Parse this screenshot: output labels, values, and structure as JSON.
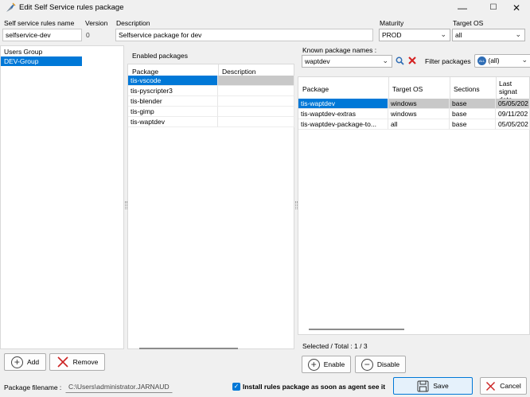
{
  "window": {
    "title": "Edit Self Service rules package",
    "min": "—",
    "max": "☐",
    "close": "✕"
  },
  "form": {
    "rules_name_label": "Self service rules name",
    "rules_name_value": "selfservice-dev",
    "version_label": "Version",
    "version_value": "0",
    "description_label": "Description",
    "description_value": "Selfservice package for dev",
    "maturity_label": "Maturity",
    "maturity_value": "PROD",
    "target_os_label": "Target OS",
    "target_os_value": "all"
  },
  "groups": {
    "header": "Users Group",
    "items": [
      "DEV-Group"
    ]
  },
  "enabled": {
    "title": "Enabled packages",
    "col_package": "Package",
    "col_description": "Description",
    "rows": [
      "tis-vscode",
      "tis-pyscripter3",
      "tis-blender",
      "tis-gimp",
      "tis-waptdev"
    ]
  },
  "known": {
    "label": "Known package names :",
    "search_value": "waptdev",
    "filter_label": "Filter packages",
    "filter_badge": "ALL",
    "filter_value": "(all)",
    "columns": [
      "Package",
      "Target OS",
      "Sections",
      "Last signature date"
    ],
    "col_last_line1": "Last signat",
    "col_last_line2": "date",
    "rows": [
      {
        "package": "tis-waptdev",
        "os": "windows",
        "section": "base",
        "date": "05/05/202"
      },
      {
        "package": "tis-waptdev-extras",
        "os": "windows",
        "section": "base",
        "date": "09/11/202"
      },
      {
        "package": "tis-waptdev-package-to...",
        "os": "all",
        "section": "base",
        "date": "05/05/202"
      }
    ],
    "selected_total": "Selected / Total : 1 / 3"
  },
  "buttons": {
    "add": "Add",
    "remove": "Remove",
    "enable": "Enable",
    "disable": "Disable",
    "save": "Save",
    "cancel": "Cancel"
  },
  "footer": {
    "filename_label": "Package filename :",
    "filename_value": "C:\\Users\\administrator.JARNAUD",
    "install_label": "Install rules package as soon as agent see it"
  }
}
